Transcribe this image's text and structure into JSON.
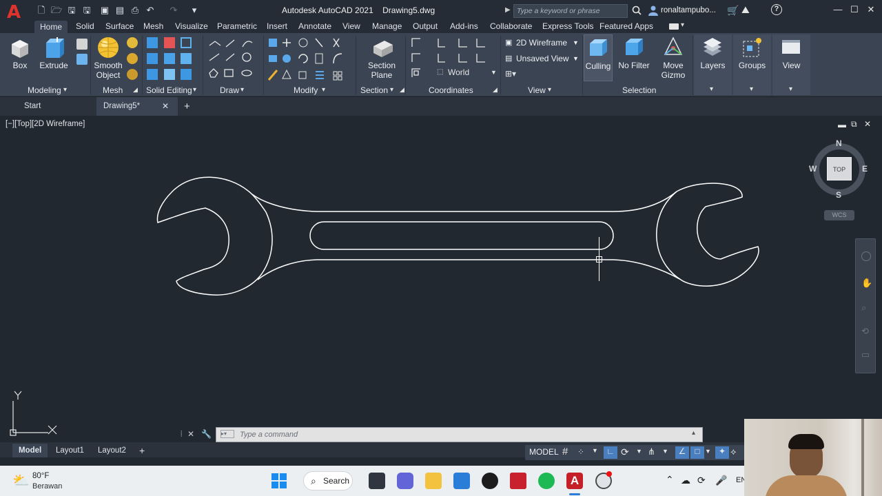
{
  "titlebar": {
    "app_title": "Autodesk AutoCAD 2021",
    "file_name": "Drawing5.dwg",
    "search_placeholder": "Type a keyword or phrase",
    "user": "ronaltampubo..."
  },
  "ribbon_tabs": [
    "Home",
    "Solid",
    "Surface",
    "Mesh",
    "Visualize",
    "Parametric",
    "Insert",
    "Annotate",
    "View",
    "Manage",
    "Output",
    "Add-ins",
    "Collaborate",
    "Express Tools",
    "Featured Apps"
  ],
  "ribbon": {
    "box_label": "Box",
    "extrude_label": "Extrude",
    "smooth_label_1": "Smooth",
    "smooth_label_2": "Object",
    "section_plane_1": "Section",
    "section_plane_2": "Plane",
    "visual_style": "2D Wireframe",
    "view_name": "Unsaved View",
    "ucs": "World",
    "culling": "Culling",
    "no_filter": "No Filter",
    "move_gizmo_1": "Move",
    "move_gizmo_2": "Gizmo",
    "layers": "Layers",
    "groups": "Groups",
    "view": "View",
    "panels": {
      "modeling": "Modeling",
      "mesh": "Mesh",
      "solid_editing": "Solid Editing",
      "draw": "Draw",
      "modify": "Modify",
      "section": "Section",
      "coordinates": "Coordinates",
      "view": "View",
      "selection": "Selection"
    }
  },
  "file_tabs": {
    "start": "Start",
    "current": "Drawing5*"
  },
  "viewport": {
    "label": "[−][Top][2D Wireframe]",
    "viewcube_top": "TOP",
    "compass_n": "N",
    "compass_s": "S",
    "compass_e": "E",
    "compass_w": "W",
    "wcs": "WCS",
    "ucs_y": "Y"
  },
  "command": {
    "placeholder": "Type  a  command"
  },
  "layout_tabs": [
    "Model",
    "Layout1",
    "Layout2"
  ],
  "status": {
    "model": "MODEL"
  },
  "taskbar": {
    "weather_temp": "80°F",
    "weather_desc": "Berawan",
    "search": "Search",
    "lang": "EN"
  }
}
